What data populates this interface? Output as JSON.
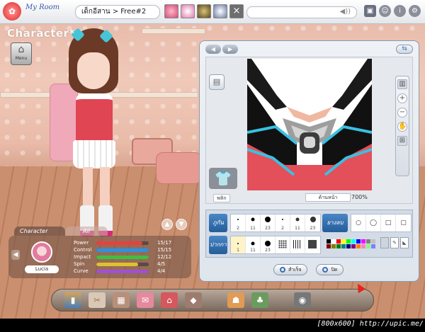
{
  "topbar": {
    "app_title": "My Room",
    "channel_label": "เด็กอีสาน > Free#2",
    "close_glyph": "×",
    "volume_glyph": "◀))",
    "icons": [
      "window-icon",
      "person-icon",
      "info-icon",
      "settings-icon"
    ]
  },
  "left": {
    "title": "Character",
    "title_mark": "*",
    "menu_label": "Menu"
  },
  "stats": {
    "tabs": [
      "Character",
      "All"
    ],
    "name": "Lucia",
    "rows": [
      {
        "label": "Power",
        "value": "15/17",
        "fraction": 0.88,
        "color": "#e84040"
      },
      {
        "label": "Control",
        "value": "15/15",
        "fraction": 1.0,
        "color": "#2f8fe0"
      },
      {
        "label": "Impact",
        "value": "12/12",
        "fraction": 1.0,
        "color": "#3fbf3f"
      },
      {
        "label": "Spin",
        "value": "4/5",
        "fraction": 0.8,
        "color": "#e0c030"
      },
      {
        "label": "Curve",
        "value": "4/4",
        "fraction": 1.0,
        "color": "#a050d0"
      }
    ]
  },
  "editor": {
    "flip_label": "พลิก",
    "face_label": "ด้านหน้า",
    "zoom_label": "700%",
    "brush_label": "ภูกัน",
    "eraser_label": "ยางลบ",
    "pen_label": "ปากกา",
    "brush_sizes": [
      "2",
      "11",
      "23",
      "2",
      "11",
      "23"
    ],
    "pen_sizes": [
      "1",
      "11",
      "23"
    ],
    "confirm_label": "สำเร็จ",
    "close_label": "ปิด",
    "palette": [
      "#000000",
      "#ffffff",
      "#ff0000",
      "#ffff00",
      "#00ff00",
      "#00ffff",
      "#0000ff",
      "#ff00ff",
      "#808080",
      "#c0c0c0",
      "#800000",
      "#808000",
      "#008000",
      "#008080",
      "#000080",
      "#800080",
      "#ff8000",
      "#ff80c0",
      "#80ff80",
      "#8080ff"
    ]
  },
  "footer": {
    "resolution_text": "[800x600] http://upic.me/"
  }
}
